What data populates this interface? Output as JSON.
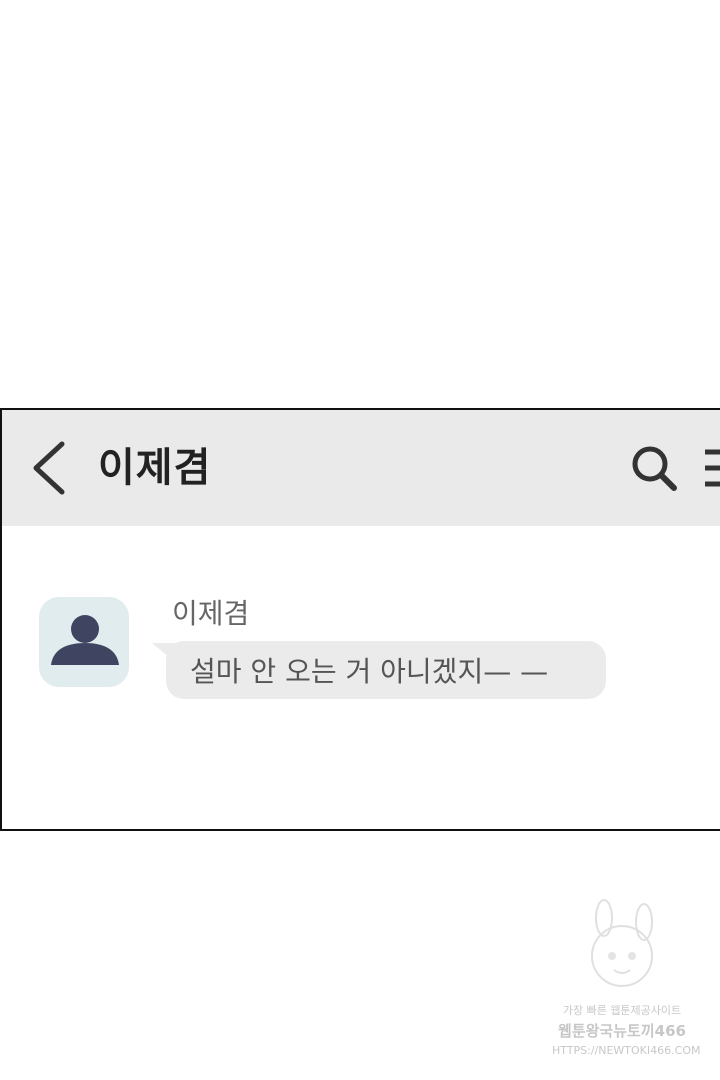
{
  "header": {
    "title": "이제겸",
    "back_icon": "chevron-left-icon",
    "search_icon": "search-icon",
    "menu_icon": "menu-icon",
    "background": "#eaeaea"
  },
  "message": {
    "sender": "이제겸",
    "text": "설마 안 오는 거 아니겠지— —",
    "avatar_icon": "person-icon",
    "avatar_bg": "#e1ecef",
    "avatar_fg": "#3f4560",
    "bubble_bg": "#ebebeb"
  },
  "watermark": {
    "line1": "가장 빠른 웹툰제공사이트",
    "line2": "웹툰왕국뉴토끼466",
    "line3": "HTTPS://NEWTOKI466.COM"
  }
}
